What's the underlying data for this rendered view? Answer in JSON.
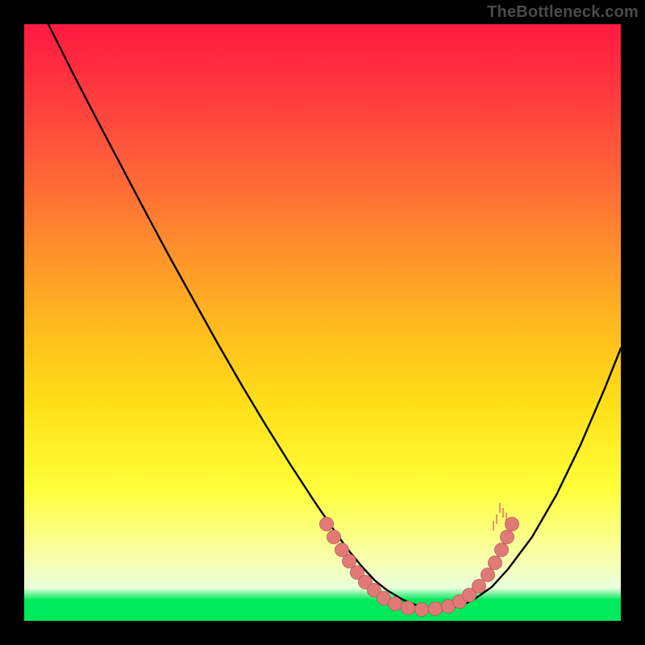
{
  "watermark": {
    "text": "TheBottleneck.com"
  },
  "colors": {
    "curve_stroke": "#000000",
    "dot_fill": "#e17a77",
    "dot_stroke": "#b95a56"
  },
  "chart_data": {
    "type": "line",
    "title": "",
    "xlabel": "",
    "ylabel": "",
    "xlim": [
      0,
      740
    ],
    "ylim": [
      0,
      740
    ],
    "series": [
      {
        "name": "bottleneck-curve",
        "note": "Coordinates are pixel positions inside the 740x740 plot area; y=0 is top. Curve descends from top-left, flattens near bottom around x≈430-540, then rises toward right edge.",
        "x": [
          30,
          60,
          90,
          120,
          150,
          180,
          210,
          240,
          270,
          300,
          330,
          360,
          390,
          405,
          420,
          435,
          450,
          470,
          490,
          510,
          530,
          545,
          560,
          580,
          600,
          630,
          660,
          690,
          720,
          740
        ],
        "y": [
          0,
          60,
          118,
          175,
          232,
          288,
          342,
          396,
          448,
          498,
          546,
          592,
          636,
          656,
          674,
          690,
          702,
          714,
          722,
          726,
          724,
          720,
          712,
          698,
          676,
          636,
          584,
          522,
          452,
          402
        ]
      }
    ],
    "dots_left": {
      "note": "Cluster of salmon dots along the left descending limb near the valley.",
      "points": [
        {
          "x": 375,
          "y": 620
        },
        {
          "x": 384,
          "y": 636
        },
        {
          "x": 394,
          "y": 652
        },
        {
          "x": 403,
          "y": 666
        },
        {
          "x": 413,
          "y": 680
        },
        {
          "x": 423,
          "y": 692
        },
        {
          "x": 434,
          "y": 702
        },
        {
          "x": 446,
          "y": 712
        },
        {
          "x": 460,
          "y": 719
        },
        {
          "x": 476,
          "y": 724
        },
        {
          "x": 493,
          "y": 726
        },
        {
          "x": 510,
          "y": 725
        }
      ]
    },
    "dots_right": {
      "note": "Cluster of salmon dots along the right ascending limb near the valley.",
      "points": [
        {
          "x": 526,
          "y": 722
        },
        {
          "x": 540,
          "y": 716
        },
        {
          "x": 552,
          "y": 708
        },
        {
          "x": 564,
          "y": 697
        },
        {
          "x": 575,
          "y": 683
        },
        {
          "x": 584,
          "y": 668
        },
        {
          "x": 592,
          "y": 652
        },
        {
          "x": 599,
          "y": 636
        },
        {
          "x": 605,
          "y": 620
        }
      ]
    },
    "ticks_right": {
      "note": "Short faint vertical tick marks near the right dot cluster (bristly look).",
      "points": [
        {
          "x": 590,
          "y": 600
        },
        {
          "x": 594,
          "y": 606
        },
        {
          "x": 598,
          "y": 612
        },
        {
          "x": 586,
          "y": 614
        },
        {
          "x": 582,
          "y": 622
        }
      ]
    }
  }
}
